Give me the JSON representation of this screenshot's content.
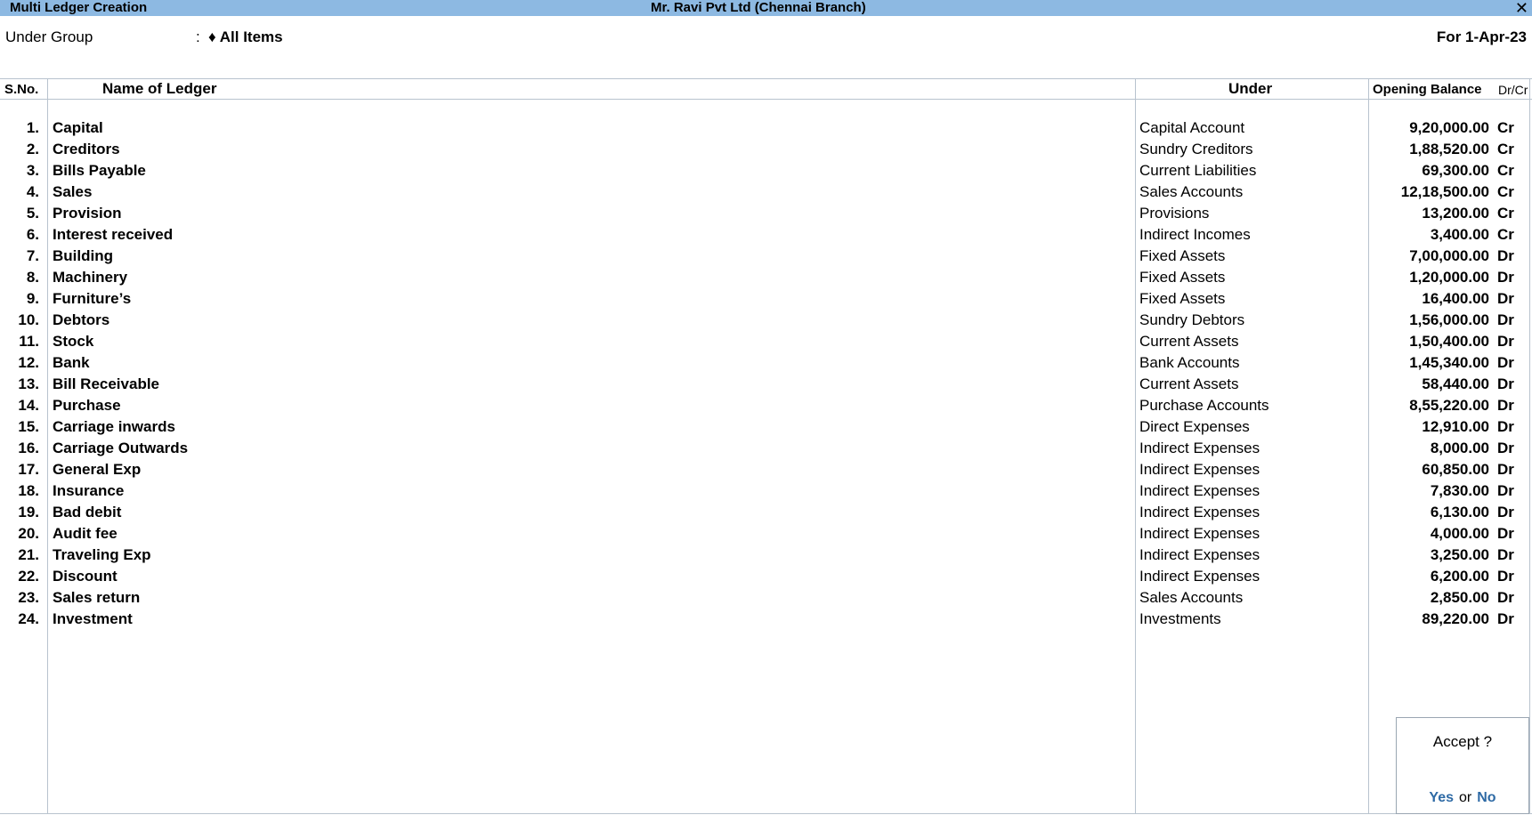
{
  "window": {
    "title_left": "Multi Ledger  Creation",
    "title_center": "Mr. Ravi Pvt Ltd (Chennai Branch)",
    "close_glyph": "✕"
  },
  "header": {
    "under_group_label": "Under Group",
    "colon": ":",
    "under_group_value": "♦ All Items",
    "for_date": "For 1-Apr-23"
  },
  "columns": {
    "sno": "S.No.",
    "name": "Name of Ledger",
    "under": "Under",
    "opening_balance": "Opening Balance",
    "drcr": "Dr/Cr"
  },
  "rows": [
    {
      "sno": "1.",
      "name": "Capital",
      "under": "Capital Account",
      "amount": "9,20,000.00",
      "drcr": "Cr"
    },
    {
      "sno": "2.",
      "name": "Creditors",
      "under": "Sundry Creditors",
      "amount": "1,88,520.00",
      "drcr": "Cr"
    },
    {
      "sno": "3.",
      "name": "Bills Payable",
      "under": "Current Liabilities",
      "amount": "69,300.00",
      "drcr": "Cr"
    },
    {
      "sno": "4.",
      "name": "Sales",
      "under": "Sales Accounts",
      "amount": "12,18,500.00",
      "drcr": "Cr"
    },
    {
      "sno": "5.",
      "name": "Provision",
      "under": "Provisions",
      "amount": "13,200.00",
      "drcr": "Cr"
    },
    {
      "sno": "6.",
      "name": "Interest received",
      "under": "Indirect Incomes",
      "amount": "3,400.00",
      "drcr": "Cr"
    },
    {
      "sno": "7.",
      "name": "Building",
      "under": "Fixed Assets",
      "amount": "7,00,000.00",
      "drcr": "Dr"
    },
    {
      "sno": "8.",
      "name": "Machinery",
      "under": "Fixed Assets",
      "amount": "1,20,000.00",
      "drcr": "Dr"
    },
    {
      "sno": "9.",
      "name": "Furniture’s",
      "under": "Fixed Assets",
      "amount": "16,400.00",
      "drcr": "Dr"
    },
    {
      "sno": "10.",
      "name": "Debtors",
      "under": "Sundry Debtors",
      "amount": "1,56,000.00",
      "drcr": "Dr"
    },
    {
      "sno": "11.",
      "name": "Stock",
      "under": "Current Assets",
      "amount": "1,50,400.00",
      "drcr": "Dr"
    },
    {
      "sno": "12.",
      "name": "Bank",
      "under": "Bank Accounts",
      "amount": "1,45,340.00",
      "drcr": "Dr"
    },
    {
      "sno": "13.",
      "name": "Bill Receivable",
      "under": "Current Assets",
      "amount": "58,440.00",
      "drcr": "Dr"
    },
    {
      "sno": "14.",
      "name": "Purchase",
      "under": "Purchase Accounts",
      "amount": "8,55,220.00",
      "drcr": "Dr"
    },
    {
      "sno": "15.",
      "name": "Carriage inwards",
      "under": "Direct Expenses",
      "amount": "12,910.00",
      "drcr": "Dr"
    },
    {
      "sno": "16.",
      "name": "Carriage Outwards",
      "under": "Indirect Expenses",
      "amount": "8,000.00",
      "drcr": "Dr"
    },
    {
      "sno": "17.",
      "name": "General Exp",
      "under": "Indirect Expenses",
      "amount": "60,850.00",
      "drcr": "Dr"
    },
    {
      "sno": "18.",
      "name": "Insurance",
      "under": "Indirect Expenses",
      "amount": "7,830.00",
      "drcr": "Dr"
    },
    {
      "sno": "19.",
      "name": "Bad debit",
      "under": "Indirect Expenses",
      "amount": "6,130.00",
      "drcr": "Dr"
    },
    {
      "sno": "20.",
      "name": "Audit fee",
      "under": "Indirect Expenses",
      "amount": "4,000.00",
      "drcr": "Dr"
    },
    {
      "sno": "21.",
      "name": "Traveling Exp",
      "under": "Indirect Expenses",
      "amount": "3,250.00",
      "drcr": "Dr"
    },
    {
      "sno": "22.",
      "name": "Discount",
      "under": "Indirect Expenses",
      "amount": "6,200.00",
      "drcr": "Dr"
    },
    {
      "sno": "23.",
      "name": "Sales return",
      "under": "Sales Accounts",
      "amount": "2,850.00",
      "drcr": "Dr"
    },
    {
      "sno": "24.",
      "name": "Investment",
      "under": "Investments",
      "amount": "89,220.00",
      "drcr": "Dr"
    }
  ],
  "dialog": {
    "question": "Accept ?",
    "yes": "Yes",
    "or": "or",
    "no": "No"
  },
  "colors": {
    "titlebar_bg": "#8db9e2",
    "accent_link": "#2e6aa5",
    "grid_line": "#b8c3ce"
  }
}
